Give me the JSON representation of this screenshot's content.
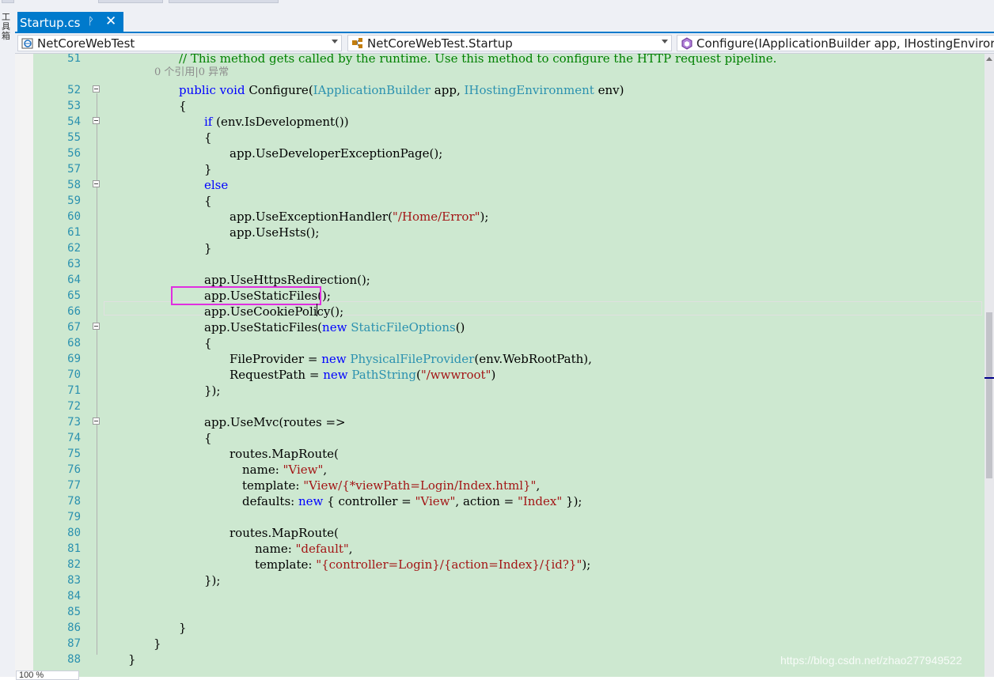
{
  "sidebar": {
    "label": "工具箱"
  },
  "tab": {
    "title": "Startup.cs",
    "pin_glyph": "ᚹ",
    "close_glyph": "✕"
  },
  "navbar": {
    "project": "NetCoreWebTest",
    "type": "NetCoreWebTest.Startup",
    "member": "Configure(IApplicationBuilder app, IHostingEnviror"
  },
  "colors": {
    "accent": "#007acc",
    "editor_bg": "#cde8d0",
    "keyword": "#0000ff",
    "type": "#2b91af",
    "string": "#a31515",
    "comment": "#008000",
    "highlight": "#e02ee0"
  },
  "codelens": "0 个引用|0 异常",
  "lines": [
    {
      "n": "51",
      "indent": 2,
      "fold": false,
      "tokens": [
        {
          "t": "// This method gets called by the runtime. Use this method to configure the HTTP request pipeline.",
          "c": "cm"
        }
      ]
    },
    {
      "n": "52",
      "indent": 2,
      "fold": true,
      "tokens": [
        {
          "t": "public",
          "c": "kw"
        },
        {
          "t": " "
        },
        {
          "t": "void",
          "c": "kw"
        },
        {
          "t": " Configure("
        },
        {
          "t": "IApplicationBuilder",
          "c": "ty"
        },
        {
          "t": " app, "
        },
        {
          "t": "IHostingEnvironment",
          "c": "ty"
        },
        {
          "t": " env)"
        }
      ]
    },
    {
      "n": "53",
      "indent": 2,
      "fold": false,
      "tokens": [
        {
          "t": "{"
        }
      ]
    },
    {
      "n": "54",
      "indent": 3,
      "fold": true,
      "tokens": [
        {
          "t": "if",
          "c": "kw"
        },
        {
          "t": " (env.IsDevelopment())"
        }
      ]
    },
    {
      "n": "55",
      "indent": 3,
      "fold": false,
      "tokens": [
        {
          "t": "{"
        }
      ]
    },
    {
      "n": "56",
      "indent": 4,
      "fold": false,
      "tokens": [
        {
          "t": "app.UseDeveloperExceptionPage();"
        }
      ]
    },
    {
      "n": "57",
      "indent": 3,
      "fold": false,
      "tokens": [
        {
          "t": "}"
        }
      ]
    },
    {
      "n": "58",
      "indent": 3,
      "fold": true,
      "tokens": [
        {
          "t": "else",
          "c": "kw"
        }
      ]
    },
    {
      "n": "59",
      "indent": 3,
      "fold": false,
      "tokens": [
        {
          "t": "{"
        }
      ]
    },
    {
      "n": "60",
      "indent": 4,
      "fold": false,
      "tokens": [
        {
          "t": "app.UseExceptionHandler("
        },
        {
          "t": "\"/Home/Error\"",
          "c": "str"
        },
        {
          "t": ");"
        }
      ]
    },
    {
      "n": "61",
      "indent": 4,
      "fold": false,
      "tokens": [
        {
          "t": "app.UseHsts();"
        }
      ]
    },
    {
      "n": "62",
      "indent": 3,
      "fold": false,
      "tokens": [
        {
          "t": "}"
        }
      ]
    },
    {
      "n": "63",
      "indent": 0,
      "fold": false,
      "tokens": []
    },
    {
      "n": "64",
      "indent": 3,
      "fold": false,
      "tokens": [
        {
          "t": "app.UseHttpsRedirection();"
        }
      ]
    },
    {
      "n": "65",
      "indent": 3,
      "fold": false,
      "tokens": [
        {
          "t": "app.UseStaticFiles();"
        }
      ]
    },
    {
      "n": "66",
      "indent": 3,
      "fold": false,
      "tokens": [
        {
          "t": "app.UseCookiePolicy();"
        }
      ]
    },
    {
      "n": "67",
      "indent": 3,
      "fold": true,
      "tokens": [
        {
          "t": "app.UseStaticFiles("
        },
        {
          "t": "new",
          "c": "kw"
        },
        {
          "t": " "
        },
        {
          "t": "StaticFileOptions",
          "c": "ty"
        },
        {
          "t": "()"
        }
      ]
    },
    {
      "n": "68",
      "indent": 3,
      "fold": false,
      "tokens": [
        {
          "t": "{"
        }
      ]
    },
    {
      "n": "69",
      "indent": 4,
      "fold": false,
      "tokens": [
        {
          "t": "FileProvider = "
        },
        {
          "t": "new",
          "c": "kw"
        },
        {
          "t": " "
        },
        {
          "t": "PhysicalFileProvider",
          "c": "ty"
        },
        {
          "t": "(env.WebRootPath),"
        }
      ]
    },
    {
      "n": "70",
      "indent": 4,
      "fold": false,
      "tokens": [
        {
          "t": "RequestPath = "
        },
        {
          "t": "new",
          "c": "kw"
        },
        {
          "t": " "
        },
        {
          "t": "PathString",
          "c": "ty"
        },
        {
          "t": "("
        },
        {
          "t": "\"/wwwroot\"",
          "c": "str"
        },
        {
          "t": ")"
        }
      ]
    },
    {
      "n": "71",
      "indent": 3,
      "fold": false,
      "tokens": [
        {
          "t": "});"
        }
      ]
    },
    {
      "n": "72",
      "indent": 0,
      "fold": false,
      "tokens": []
    },
    {
      "n": "73",
      "indent": 3,
      "fold": true,
      "tokens": [
        {
          "t": "app.UseMvc(routes =>"
        }
      ]
    },
    {
      "n": "74",
      "indent": 3,
      "fold": false,
      "tokens": [
        {
          "t": "{"
        }
      ]
    },
    {
      "n": "75",
      "indent": 4,
      "fold": false,
      "tokens": [
        {
          "t": "routes.MapRoute("
        }
      ]
    },
    {
      "n": "76",
      "indent": 4.5,
      "fold": false,
      "tokens": [
        {
          "t": "name: "
        },
        {
          "t": "\"View\"",
          "c": "str"
        },
        {
          "t": ","
        }
      ]
    },
    {
      "n": "77",
      "indent": 4.5,
      "fold": false,
      "tokens": [
        {
          "t": "template: "
        },
        {
          "t": "\"View/{*viewPath=Login/Index.html}\"",
          "c": "str"
        },
        {
          "t": ","
        }
      ]
    },
    {
      "n": "78",
      "indent": 4.5,
      "fold": false,
      "tokens": [
        {
          "t": "defaults: "
        },
        {
          "t": "new",
          "c": "kw"
        },
        {
          "t": " { controller = "
        },
        {
          "t": "\"View\"",
          "c": "str"
        },
        {
          "t": ", action = "
        },
        {
          "t": "\"Index\"",
          "c": "str"
        },
        {
          "t": " });"
        }
      ]
    },
    {
      "n": "79",
      "indent": 0,
      "fold": false,
      "tokens": []
    },
    {
      "n": "80",
      "indent": 4,
      "fold": false,
      "tokens": [
        {
          "t": "routes.MapRoute("
        }
      ]
    },
    {
      "n": "81",
      "indent": 5,
      "fold": false,
      "tokens": [
        {
          "t": "name: "
        },
        {
          "t": "\"default\"",
          "c": "str"
        },
        {
          "t": ","
        }
      ]
    },
    {
      "n": "82",
      "indent": 5,
      "fold": false,
      "tokens": [
        {
          "t": "template: "
        },
        {
          "t": "\"{controller=Login}/{action=Index}/{id?}\"",
          "c": "str"
        },
        {
          "t": ");"
        }
      ]
    },
    {
      "n": "83",
      "indent": 3,
      "fold": false,
      "tokens": [
        {
          "t": "});"
        }
      ]
    },
    {
      "n": "84",
      "indent": 0,
      "fold": false,
      "tokens": []
    },
    {
      "n": "85",
      "indent": 0,
      "fold": false,
      "tokens": []
    },
    {
      "n": "86",
      "indent": 2,
      "fold": false,
      "tokens": [
        {
          "t": "}"
        }
      ]
    },
    {
      "n": "87",
      "indent": 1,
      "fold": false,
      "tokens": [
        {
          "t": "}"
        }
      ]
    },
    {
      "n": "88",
      "indent": 0,
      "fold": false,
      "tokens": [
        {
          "t": "}"
        }
      ]
    }
  ],
  "zoom": "100 %",
  "watermark": "https://blog.csdn.net/zhao277949522"
}
